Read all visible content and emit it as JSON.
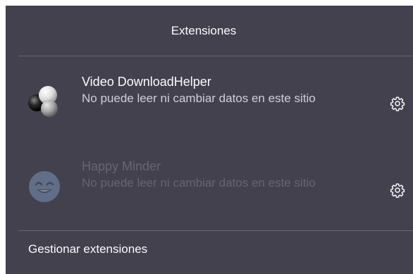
{
  "panel": {
    "title": "Extensiones"
  },
  "extensions": [
    {
      "name": "Video DownloadHelper",
      "description": "No puede leer ni cambiar datos en este sitio",
      "icon": "molecule-icon",
      "enabled": true
    },
    {
      "name": "Happy Minder",
      "description": "No puede leer ni cambiar datos en este sitio",
      "icon": "smiley-icon",
      "enabled": false
    }
  ],
  "footer": {
    "manage_label": "Gestionar extensiones"
  },
  "colors": {
    "panel_bg": "#42414d",
    "text": "#fbfbfe",
    "secondary_text": "#cfcfd8",
    "disabled_text": "#67666f",
    "divider": "#6b6a77"
  }
}
